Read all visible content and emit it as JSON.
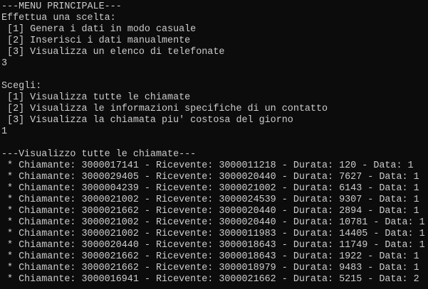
{
  "colors": {
    "background": "#0c0c0c",
    "text": "#cccccc"
  },
  "menu": {
    "header": "---MENU PRINCIPALE---",
    "prompt": "Effettua una scelta:",
    "options": [
      " [1] Genera i dati in modo casuale",
      " [2] Inserisci i dati manualmente",
      " [3] Visualizza un elenco di telefonate"
    ],
    "input": "3"
  },
  "submenu": {
    "prompt": "Scegli:",
    "options": [
      " [1] Visualizza tutte le chiamate",
      " [2] Visualizza le informazioni specifiche di un contatto",
      " [3] Visualizza la chiamata piu' costosa del giorno"
    ],
    "input": "1"
  },
  "list": {
    "header": "---Visualizzo tutte le chiamate---",
    "rows": [
      " * Chiamante: 3000017141 - Ricevente: 3000011218 - Durata: 120 - Data: 1",
      " * Chiamante: 3000029405 - Ricevente: 3000020440 - Durata: 7627 - Data: 1",
      " * Chiamante: 3000004239 - Ricevente: 3000021002 - Durata: 6143 - Data: 1",
      " * Chiamante: 3000021002 - Ricevente: 3000024539 - Durata: 9307 - Data: 1",
      " * Chiamante: 3000021662 - Ricevente: 3000020440 - Durata: 2894 - Data: 1",
      " * Chiamante: 3000021002 - Ricevente: 3000020440 - Durata: 10781 - Data: 1",
      " * Chiamante: 3000021002 - Ricevente: 3000011983 - Durata: 14405 - Data: 1",
      " * Chiamante: 3000020440 - Ricevente: 3000018643 - Durata: 11749 - Data: 1",
      " * Chiamante: 3000021662 - Ricevente: 3000018643 - Durata: 1922 - Data: 1",
      " * Chiamante: 3000021662 - Ricevente: 3000018979 - Durata: 9483 - Data: 1",
      " * Chiamante: 3000016941 - Ricevente: 3000021662 - Durata: 5215 - Data: 2"
    ]
  }
}
